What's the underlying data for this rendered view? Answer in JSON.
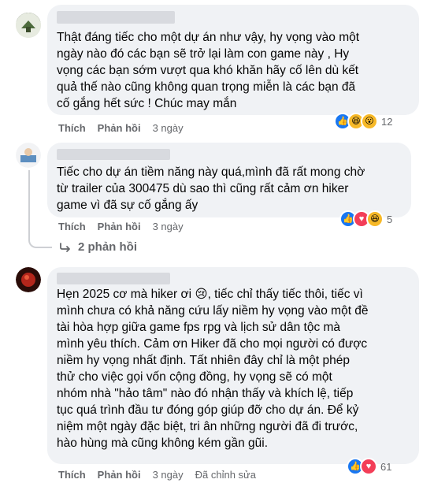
{
  "comments": [
    {
      "text": "Thật đáng tiếc cho một dự án như vậy, hy vọng vào một\nngày nào đó các bạn sẽ trở lại làm con game này , Hy\nvọng các bạn sớm vượt qua khó khăn hãy cố lên dù kết\nquả thế nào cũng không quan trọng miễn là các bạn đã\ncố gắng hết sức ! Chúc may mắn",
      "actions": {
        "like": "Thích",
        "reply": "Phản hồi",
        "time": "3 ngày"
      },
      "reactions": {
        "icons": [
          "like-icon",
          "haha-icon",
          "wow-icon"
        ],
        "count": "12"
      }
    },
    {
      "text": "Tiếc cho dự án tiềm năng này quá,mình đã rất mong chờ\ntừ trailer của 300475 dù sao thì cũng rất cảm ơn hiker\ngame vì đã sự cố gắng ấy",
      "actions": {
        "like": "Thích",
        "reply": "Phản hồi",
        "time": "3 ngày"
      },
      "reactions": {
        "icons": [
          "like-icon",
          "heart-icon",
          "haha-icon"
        ],
        "count": "5"
      },
      "replies_label": "2 phản hồi"
    },
    {
      "text": "Hẹn 2025 cơ mà hiker ơi 😢, tiếc chỉ thấy tiếc thôi, tiếc vì\nmình chưa có khả năng cứu lấy niềm hy vọng vào một đề\ntài hòa hợp giữa game fps rpg và lịch sử dân tộc mà\nmình yêu thích. Cảm ơn Hiker đã cho mọi người có được\nniềm hy vọng nhất định. Tất nhiên đây chỉ là một phép\nthử cho việc gọi vốn cộng đồng, hy vọng sẽ có một\nnhóm nhà \"hảo tâm\" nào đó nhận thấy và khích lệ, tiếp\ntục quá trình đầu tư đóng góp giúp đỡ cho dự án. Để kỷ\nniệm một ngày đặc biệt, tri ân những người đã đi trước,\nhào hùng mà cũng không kém gần gũi.",
      "actions": {
        "like": "Thích",
        "reply": "Phản hồi",
        "time": "3 ngày",
        "edited": "Đã chỉnh sửa"
      },
      "reactions": {
        "icons": [
          "like-icon",
          "heart-icon"
        ],
        "count": "61"
      }
    }
  ],
  "colors": {
    "like": "#1877f2",
    "heart": "#f33e58",
    "haha": "#f7b928",
    "bubble": "#f0f2f5",
    "meta": "#65676b"
  }
}
